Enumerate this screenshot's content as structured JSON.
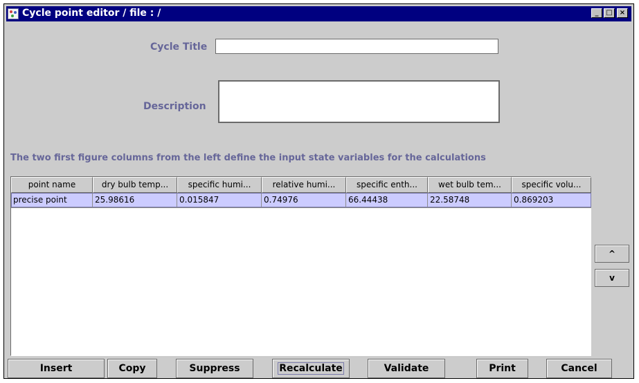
{
  "window": {
    "title": "Cycle point editor / file :  /",
    "controls": {
      "minimize": "_",
      "maximize": "□",
      "close": "×"
    }
  },
  "form": {
    "cycle_title_label": "Cycle Title",
    "cycle_title_value": "",
    "description_label": "Description",
    "description_value": ""
  },
  "info_text": "The two first figure columns from the left define the input state variables for the calculations",
  "table": {
    "columns": [
      "point name",
      "dry bulb temp...",
      "specific humi...",
      "relative humi...",
      "specific enth...",
      "wet bulb tem...",
      "specific volu..."
    ],
    "rows": [
      [
        "precise point",
        "25.98616",
        "0.015847",
        "0.74976",
        "66.44438",
        "22.58748",
        "0.869203"
      ]
    ]
  },
  "side_buttons": {
    "up": "^",
    "down": "v"
  },
  "buttons": [
    "Insert",
    "Copy",
    "Suppress",
    "Recalculate",
    "Validate",
    "Print",
    "Cancel"
  ],
  "colors": {
    "title_bar": "#000080",
    "label": "#666699",
    "selection": "#ccccff",
    "panel": "#cccccc"
  }
}
